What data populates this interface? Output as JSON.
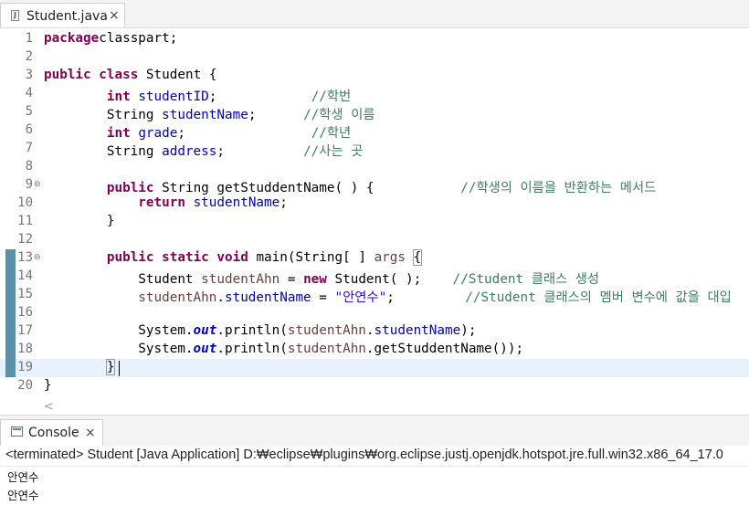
{
  "editor_tab": {
    "label": "Student.java",
    "close": "×",
    "icon": "java-file-icon"
  },
  "code": [
    {
      "n": "1",
      "fold": "",
      "current": false,
      "changed": false,
      "segs": [
        [
          "kw",
          "package"
        ],
        [
          "",
          "classpart;"
        ]
      ]
    },
    {
      "n": "2",
      "fold": "",
      "current": false,
      "changed": false,
      "segs": []
    },
    {
      "n": "3",
      "fold": "",
      "current": false,
      "changed": false,
      "segs": [
        [
          "kw",
          "public"
        ],
        [
          "",
          " "
        ],
        [
          "kw",
          "class"
        ],
        [
          "",
          " Student {"
        ]
      ]
    },
    {
      "n": "4",
      "fold": "",
      "current": false,
      "changed": false,
      "segs": [
        [
          "",
          "        "
        ],
        [
          "kw",
          "int"
        ],
        [
          "",
          " "
        ],
        [
          "fld",
          "studentID"
        ],
        [
          "",
          ";            "
        ],
        [
          "cmt",
          "//학번"
        ]
      ]
    },
    {
      "n": "5",
      "fold": "",
      "current": false,
      "changed": false,
      "segs": [
        [
          "",
          "        String "
        ],
        [
          "fld",
          "studentName"
        ],
        [
          "",
          ";      "
        ],
        [
          "cmt",
          "//학생 이름"
        ]
      ]
    },
    {
      "n": "6",
      "fold": "",
      "current": false,
      "changed": false,
      "segs": [
        [
          "",
          "        "
        ],
        [
          "kw",
          "int"
        ],
        [
          "",
          " "
        ],
        [
          "fld",
          "grade"
        ],
        [
          "",
          ";                "
        ],
        [
          "cmt",
          "//학년"
        ]
      ]
    },
    {
      "n": "7",
      "fold": "",
      "current": false,
      "changed": false,
      "segs": [
        [
          "",
          "        String "
        ],
        [
          "fld",
          "address"
        ],
        [
          "",
          ";          "
        ],
        [
          "cmt",
          "//사는 곳"
        ]
      ]
    },
    {
      "n": "8",
      "fold": "",
      "current": false,
      "changed": false,
      "segs": []
    },
    {
      "n": "9",
      "fold": "⊖",
      "current": false,
      "changed": false,
      "segs": [
        [
          "",
          "        "
        ],
        [
          "kw",
          "public"
        ],
        [
          "",
          " String getStuddentName( ) {           "
        ],
        [
          "cmt",
          "//학생의 이름을 반환하는 메서드"
        ]
      ]
    },
    {
      "n": "10",
      "fold": "",
      "current": false,
      "changed": false,
      "segs": [
        [
          "",
          "            "
        ],
        [
          "kw",
          "return"
        ],
        [
          "",
          " "
        ],
        [
          "fld",
          "studentName"
        ],
        [
          "",
          ";"
        ]
      ]
    },
    {
      "n": "11",
      "fold": "",
      "current": false,
      "changed": false,
      "segs": [
        [
          "",
          "        }"
        ]
      ]
    },
    {
      "n": "12",
      "fold": "",
      "current": false,
      "changed": false,
      "segs": []
    },
    {
      "n": "13",
      "fold": "⊖",
      "current": false,
      "changed": true,
      "segs": [
        [
          "",
          "        "
        ],
        [
          "kw",
          "public"
        ],
        [
          "",
          " "
        ],
        [
          "kw",
          "static"
        ],
        [
          "",
          " "
        ],
        [
          "kw",
          "void"
        ],
        [
          "",
          " main(String[ ] "
        ],
        [
          "lv",
          "args"
        ],
        [
          "",
          " "
        ],
        [
          "brk",
          "{"
        ]
      ]
    },
    {
      "n": "14",
      "fold": "",
      "current": false,
      "changed": true,
      "segs": [
        [
          "",
          "            Student "
        ],
        [
          "lv",
          "studentAhn"
        ],
        [
          "",
          " = "
        ],
        [
          "kw",
          "new"
        ],
        [
          "",
          " Student( );    "
        ],
        [
          "cmt",
          "//Student 클래스 생성"
        ]
      ]
    },
    {
      "n": "15",
      "fold": "",
      "current": false,
      "changed": true,
      "segs": [
        [
          "",
          "            "
        ],
        [
          "lv",
          "studentAhn"
        ],
        [
          "",
          "."
        ],
        [
          "fld",
          "studentName"
        ],
        [
          "",
          " = "
        ],
        [
          "str",
          "\"안연수\""
        ],
        [
          "",
          ";         "
        ],
        [
          "cmt",
          "//Student 클래스의 멤버 변수에 값을 대입"
        ]
      ]
    },
    {
      "n": "16",
      "fold": "",
      "current": false,
      "changed": true,
      "segs": []
    },
    {
      "n": "17",
      "fold": "",
      "current": false,
      "changed": true,
      "segs": [
        [
          "",
          "            System."
        ],
        [
          "stat",
          "out"
        ],
        [
          "",
          ".println("
        ],
        [
          "lv",
          "studentAhn"
        ],
        [
          "",
          "."
        ],
        [
          "fld",
          "studentName"
        ],
        [
          "",
          ");"
        ]
      ]
    },
    {
      "n": "18",
      "fold": "",
      "current": false,
      "changed": true,
      "segs": [
        [
          "",
          "            System."
        ],
        [
          "stat",
          "out"
        ],
        [
          "",
          ".println("
        ],
        [
          "lv",
          "studentAhn"
        ],
        [
          "",
          ".getStuddentName());"
        ]
      ]
    },
    {
      "n": "19",
      "fold": "",
      "current": true,
      "changed": true,
      "segs": [
        [
          "",
          "        "
        ],
        [
          "brk",
          "}"
        ]
      ]
    },
    {
      "n": "20",
      "fold": "",
      "current": false,
      "changed": false,
      "segs": [
        [
          "",
          "}"
        ]
      ]
    }
  ],
  "editor_scroll_arrow": "<",
  "console_tab": {
    "label": "Console",
    "close": "×",
    "icon": "console-icon"
  },
  "console": {
    "status": "<terminated> Student [Java Application] D:₩eclipse₩plugins₩org.eclipse.justj.openjdk.hotspot.jre.full.win32.x86_64_17.0",
    "output": [
      "안연수",
      "안연수"
    ]
  },
  "colors": {
    "keyword": "#7f0055",
    "field": "#0000c0",
    "local_var": "#6a3e3e",
    "string": "#2a00ff",
    "comment": "#3f7f5f",
    "current_line": "#e8f2fe",
    "change_bar": "#5c8fa8"
  }
}
